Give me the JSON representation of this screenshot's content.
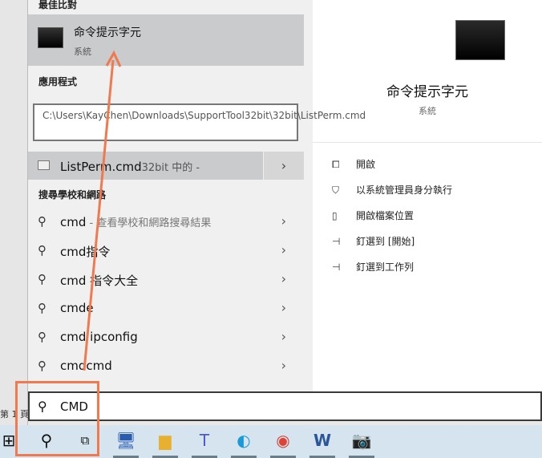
{
  "document": {
    "page_indicator": "第 1 頁"
  },
  "left_panel": {
    "best_match_header": "最佳比對",
    "best_match": {
      "title": "命令提示字元",
      "subtitle": "系統",
      "icon": "command-prompt-icon"
    },
    "apps_header": "應用程式",
    "tooltip": "C:\\Users\\KayChen\\Downloads\\SupportTool32bit\\32bit\\ListPerm.cmd",
    "app_item": {
      "name": "ListPerm.cmd",
      "location": "32bit 中的 -",
      "icon": "batch-file-icon"
    },
    "web_header": "搜尋學校和網路",
    "web_items": [
      {
        "text": "cmd",
        "suffix": " - 查看學校和網路搜尋結果"
      },
      {
        "text": "cmd指令",
        "suffix": ""
      },
      {
        "text": "cmd 指令大全",
        "suffix": ""
      },
      {
        "text": "cmde",
        "suffix": ""
      },
      {
        "text": "cmd ipconfig",
        "suffix": ""
      },
      {
        "text": "cmdcmd",
        "suffix": ""
      }
    ]
  },
  "right_panel": {
    "title": "命令提示字元",
    "subtitle": "系統",
    "actions": [
      {
        "label": "開啟",
        "icon": "open-icon"
      },
      {
        "label": "以系統管理員身分執行",
        "icon": "shield-icon"
      },
      {
        "label": "開啟檔案位置",
        "icon": "folder-icon"
      },
      {
        "label": "釘選到 [開始]",
        "icon": "pin-icon"
      },
      {
        "label": "釘選到工作列",
        "icon": "pin-icon"
      }
    ]
  },
  "search": {
    "value": "CMD"
  },
  "taskbar": {
    "apps": [
      "remote-desktop",
      "file-explorer",
      "teams",
      "edge",
      "chrome",
      "word",
      "camera"
    ]
  },
  "annotation_color": "#f07a50"
}
